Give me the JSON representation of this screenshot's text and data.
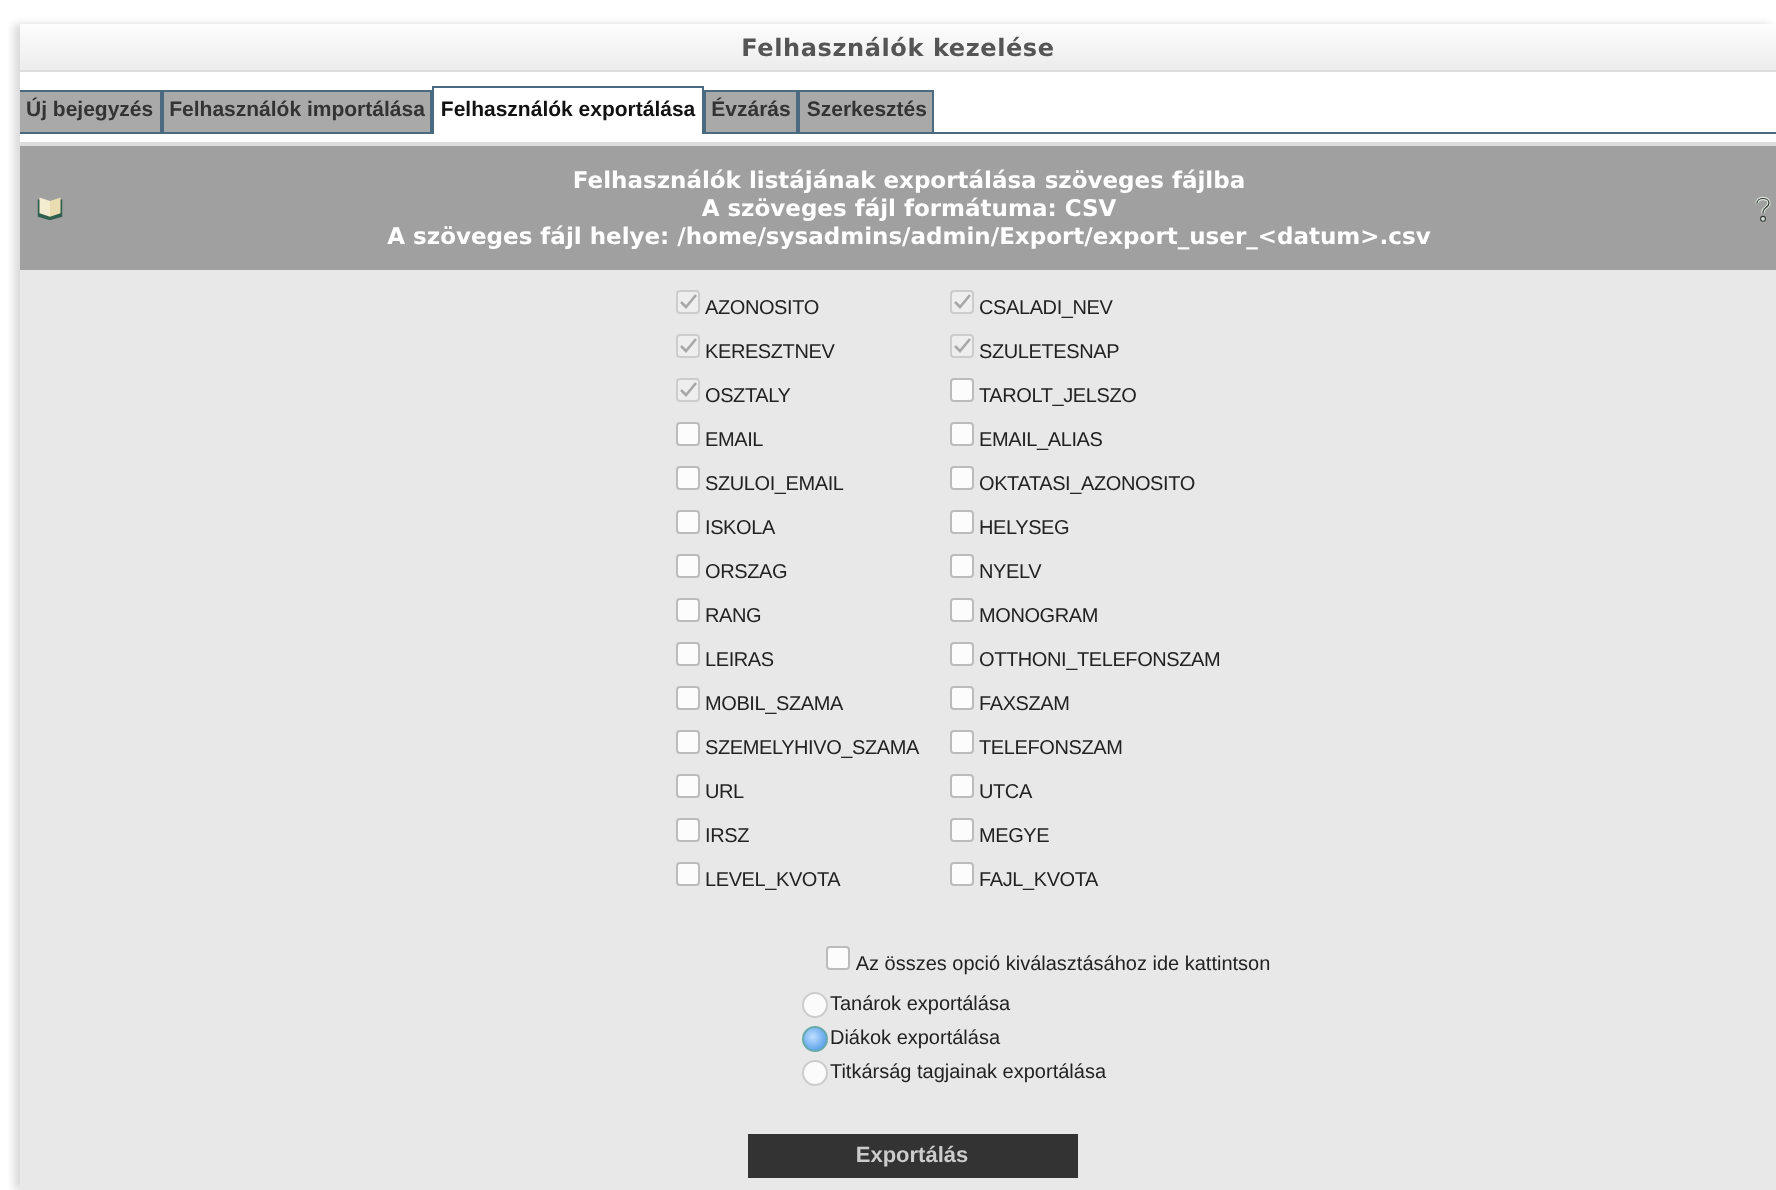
{
  "window": {
    "title": "Felhasználók kezelése"
  },
  "tabs": [
    {
      "label": "Új bejegyzés",
      "selected": false
    },
    {
      "label": "Felhasználók importálása",
      "selected": false
    },
    {
      "label": "Felhasználók exportálása",
      "selected": true
    },
    {
      "label": "Évzárás",
      "selected": false
    },
    {
      "label": "Szerkesztés",
      "selected": false
    }
  ],
  "header": {
    "lines": [
      "Felhasználók listájának exportálása szöveges fájlba",
      "A szöveges fájl formátuma: CSV",
      "A szöveges fájl helye: /home/sysadmins/admin/Export/export_user_<datum>.csv"
    ]
  },
  "fields": [
    {
      "label": "AZONOSITO",
      "checked": true,
      "disabled": true
    },
    {
      "label": "CSALADI_NEV",
      "checked": true,
      "disabled": true
    },
    {
      "label": "KERESZTNEV",
      "checked": true,
      "disabled": true
    },
    {
      "label": "SZULETESNAP",
      "checked": true,
      "disabled": true
    },
    {
      "label": "OSZTALY",
      "checked": true,
      "disabled": true
    },
    {
      "label": "TAROLT_JELSZO",
      "checked": false,
      "disabled": false
    },
    {
      "label": "EMAIL",
      "checked": false,
      "disabled": false
    },
    {
      "label": "EMAIL_ALIAS",
      "checked": false,
      "disabled": false
    },
    {
      "label": "SZULOI_EMAIL",
      "checked": false,
      "disabled": false
    },
    {
      "label": "OKTATASI_AZONOSITO",
      "checked": false,
      "disabled": false
    },
    {
      "label": "ISKOLA",
      "checked": false,
      "disabled": false
    },
    {
      "label": "HELYSEG",
      "checked": false,
      "disabled": false
    },
    {
      "label": "ORSZAG",
      "checked": false,
      "disabled": false
    },
    {
      "label": "NYELV",
      "checked": false,
      "disabled": false
    },
    {
      "label": "RANG",
      "checked": false,
      "disabled": false
    },
    {
      "label": "MONOGRAM",
      "checked": false,
      "disabled": false
    },
    {
      "label": "LEIRAS",
      "checked": false,
      "disabled": false
    },
    {
      "label": "OTTHONI_TELEFONSZAM",
      "checked": false,
      "disabled": false
    },
    {
      "label": "MOBIL_SZAMA",
      "checked": false,
      "disabled": false
    },
    {
      "label": "FAXSZAM",
      "checked": false,
      "disabled": false
    },
    {
      "label": "SZEMELYHIVO_SZAMA",
      "checked": false,
      "disabled": false
    },
    {
      "label": "TELEFONSZAM",
      "checked": false,
      "disabled": false
    },
    {
      "label": "URL",
      "checked": false,
      "disabled": false
    },
    {
      "label": "UTCA",
      "checked": false,
      "disabled": false
    },
    {
      "label": "IRSZ",
      "checked": false,
      "disabled": false
    },
    {
      "label": "MEGYE",
      "checked": false,
      "disabled": false
    },
    {
      "label": "LEVEL_KVOTA",
      "checked": false,
      "disabled": false
    },
    {
      "label": "FAJL_KVOTA",
      "checked": false,
      "disabled": false
    }
  ],
  "select_all": {
    "label": "Az összes opció kiválasztásához ide kattintson",
    "checked": false
  },
  "export_options": [
    {
      "label": "Tanárok exportálása",
      "selected": false
    },
    {
      "label": "Diákok exportálása",
      "selected": true
    },
    {
      "label": "Titkárság tagjainak exportálása",
      "selected": false
    }
  ],
  "button": "Exportálás"
}
